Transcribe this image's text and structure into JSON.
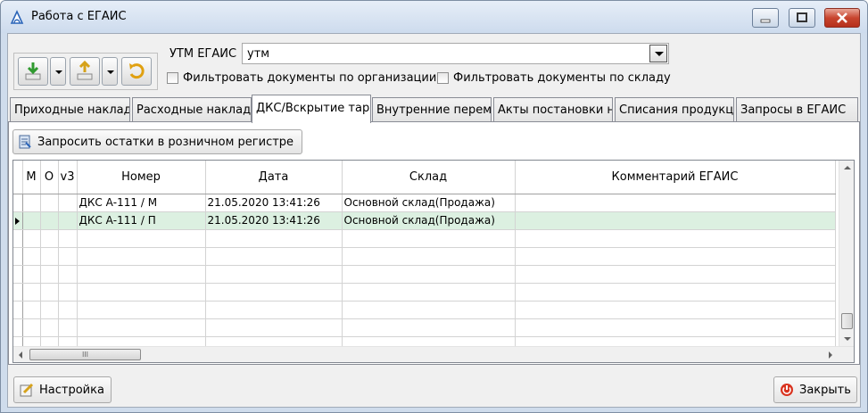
{
  "window": {
    "title": "Работа с ЕГАИС"
  },
  "header": {
    "utm_label": "УТМ ЕГАИС",
    "utm_value": "утм",
    "filter_org_label": "Фильтровать документы по организации",
    "filter_store_label": "Фильтровать документы по складу"
  },
  "toolbar": {
    "icons": [
      "download-icon",
      "upload-icon",
      "refresh-icon"
    ]
  },
  "tabs": [
    {
      "label": "Приходные накладные",
      "active": false
    },
    {
      "label": "Расходные накладные",
      "active": false
    },
    {
      "label": "ДКС/Вскрытие тары",
      "active": true
    },
    {
      "label": "Внутренние перемещения",
      "active": false
    },
    {
      "label": "Акты постановки на баланс",
      "active": false
    },
    {
      "label": "Списания продукции",
      "active": false
    },
    {
      "label": "Запросы в ЕГАИС",
      "active": false
    }
  ],
  "panel": {
    "request_button_label": "Запросить остатки в розничном регистре"
  },
  "grid": {
    "columns": [
      "М",
      "О",
      "v3",
      "Номер",
      "Дата",
      "Склад",
      "Комментарий ЕГАИС"
    ],
    "rows": [
      {
        "m": "",
        "o": "",
        "v3": "",
        "number": "ДКС А-111 / М",
        "date": "21.05.2020 13:41:26",
        "store": "Основной склад(Продажа)",
        "comment": ""
      },
      {
        "m": "",
        "o": "",
        "v3": "",
        "number": "ДКС А-111 / П",
        "date": "21.05.2020 13:41:26",
        "store": "Основной склад(Продажа)",
        "comment": ""
      }
    ],
    "selected_row": 1,
    "hscroll_thumb_label": "III"
  },
  "footer": {
    "settings_label": "Настройка",
    "close_label": "Закрыть"
  },
  "colors": {
    "selected_row": "#dcf0e1",
    "titlebar": "#cddbed",
    "close_button": "#c8452f"
  }
}
